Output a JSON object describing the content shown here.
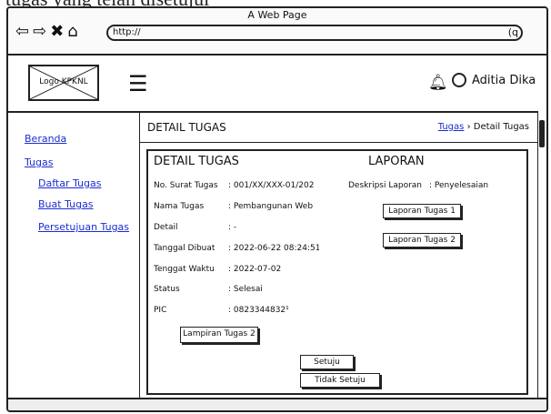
{
  "caption": "tugas yang telah disetujui",
  "window": {
    "title": "A Web Page",
    "url": "http://"
  },
  "header": {
    "logo_text": "Logo KPKNL",
    "user_name": "Aditia Dika"
  },
  "sidebar": {
    "items": [
      {
        "label": "Beranda"
      },
      {
        "label": "Tugas"
      },
      {
        "label": "Daftar Tugas"
      },
      {
        "label": "Buat Tugas"
      },
      {
        "label": "Persetujuan Tugas"
      }
    ]
  },
  "page": {
    "title": "DETAIL TUGAS",
    "breadcrumb": {
      "parent": "Tugas",
      "separator": "›",
      "current": "Detail Tugas"
    }
  },
  "detail": {
    "heading": "DETAIL TUGAS",
    "fields": [
      {
        "label": "No. Surat Tugas",
        "value": ": 001/XX/XXX-01/202"
      },
      {
        "label": "Nama Tugas",
        "value": ": Pembangunan Web"
      },
      {
        "label": "Detail",
        "value": ": -"
      },
      {
        "label": "Tanggal Dibuat",
        "value": ": 2022-06-22 08:24:51"
      },
      {
        "label": "Tenggat Waktu",
        "value": ": 2022-07-02"
      },
      {
        "label": "Status",
        "value": ": Selesai"
      },
      {
        "label": "PIC",
        "value": ": 0823344832¹"
      }
    ],
    "attachment_button": "Lampiran Tugas 2"
  },
  "report": {
    "heading": "LAPORAN",
    "desc_label": "Deskripsi Laporan",
    "desc_value": ": Penyelesaian",
    "buttons": [
      "Laporan Tugas 1",
      "Laporan Tugas 2"
    ]
  },
  "actions": {
    "approve": "Setuju",
    "reject": "Tidak Setuju"
  }
}
